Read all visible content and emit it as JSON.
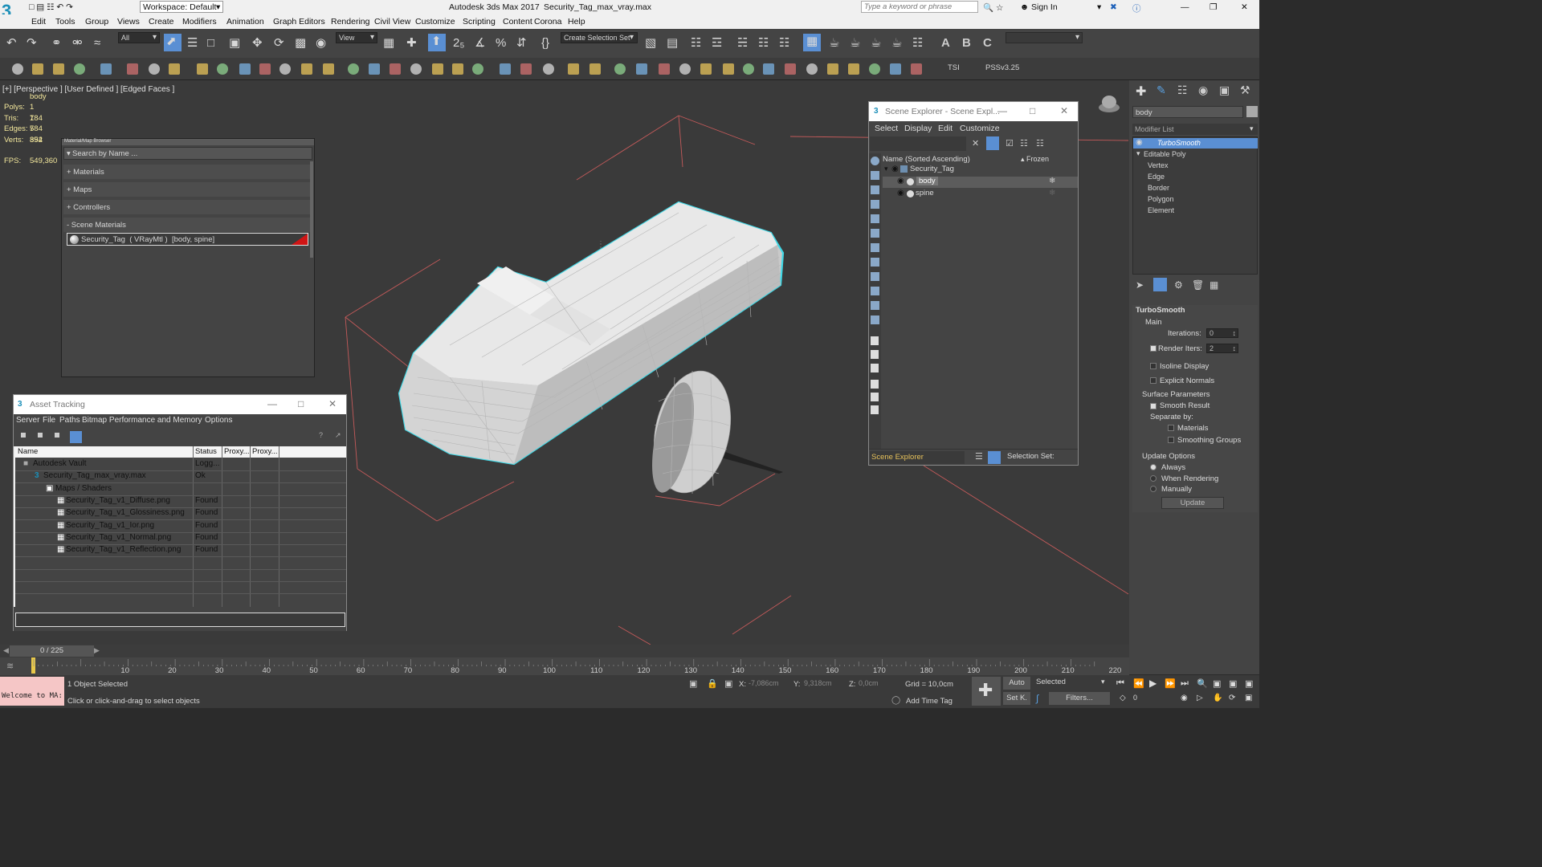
{
  "app": {
    "title": "Autodesk 3ds Max 2017",
    "file": "Security_Tag_max_vray.max",
    "workspace": "Workspace: Default",
    "search_placeholder": "Type a keyword or phrase",
    "sign_in": "Sign In"
  },
  "menu": [
    "Edit",
    "Tools",
    "Group",
    "Views",
    "Create",
    "Modifiers",
    "Animation",
    "Graph Editors",
    "Rendering",
    "Civil View",
    "Customize",
    "Scripting",
    "Content",
    "Corona",
    "Help"
  ],
  "toolbar": {
    "filter": "All",
    "refcoord": "View",
    "selset": "Create Selection Set",
    "tsi": "TSI",
    "pss": "PSSv3.25"
  },
  "viewport": {
    "label": "[+] [Perspective ] [User Defined ] [Edged Faces ]",
    "object": "body",
    "stats": [
      {
        "k": "Polys:",
        "v": "1 784"
      },
      {
        "k": "Tris:",
        "v": "1 784"
      },
      {
        "k": "Edges:",
        "v": "5 352"
      },
      {
        "k": "Verts:",
        "v": "894"
      }
    ],
    "fps_label": "FPS:",
    "fps": "549,360"
  },
  "material_browser": {
    "title": "Material/Map Browser",
    "search": "Search by Name ...",
    "groups": [
      {
        "label": "+ Materials"
      },
      {
        "label": "+ Maps"
      },
      {
        "label": "+ Controllers"
      },
      {
        "label": "- Scene Materials"
      }
    ],
    "scene_material": "Security_Tag  ( VRayMtl )  [body, spine]"
  },
  "asset_tracking": {
    "title": "Asset Tracking",
    "menu": [
      "Server",
      "File",
      "Paths",
      "Bitmap Performance and Memory",
      "Options"
    ],
    "columns": [
      "Name",
      "Status",
      "Proxy...",
      "Proxy..."
    ],
    "rows": [
      {
        "name": "Autodesk Vault",
        "status": "Logg..."
      },
      {
        "name": "Security_Tag_max_vray.max",
        "status": "Ok"
      },
      {
        "name": "Maps / Shaders",
        "status": ""
      },
      {
        "name": "Security_Tag_v1_Diffuse.png",
        "status": "Found"
      },
      {
        "name": "Security_Tag_v1_Glossiness.png",
        "status": "Found"
      },
      {
        "name": "Security_Tag_v1_Ior.png",
        "status": "Found"
      },
      {
        "name": "Security_Tag_v1_Normal.png",
        "status": "Found"
      },
      {
        "name": "Security_Tag_v1_Reflection.png",
        "status": "Found"
      }
    ]
  },
  "scene_explorer": {
    "title": "Scene Explorer - Scene Expl...",
    "menu": [
      "Select",
      "Display",
      "Edit",
      "Customize"
    ],
    "col_name": "Name (Sorted Ascending)",
    "col_frozen": "▴ Frozen",
    "items": [
      {
        "name": "Security_Tag"
      },
      {
        "name": "body"
      },
      {
        "name": "spine"
      }
    ],
    "footer_name": "Scene Explorer",
    "footer_set": "Selection Set:"
  },
  "command_panel": {
    "object_name": "body",
    "modifier_list": "Modifier List",
    "stack": [
      {
        "name": "TurboSmooth"
      },
      {
        "name": "Editable Poly"
      },
      {
        "name": "Vertex"
      },
      {
        "name": "Edge"
      },
      {
        "name": "Border"
      },
      {
        "name": "Polygon"
      },
      {
        "name": "Element"
      }
    ],
    "rollout": "TurboSmooth",
    "main": "Main",
    "iterations_label": "Iterations:",
    "iterations": "0",
    "render_iters_label": "Render Iters:",
    "render_iters": "2",
    "isoline": "Isoline Display",
    "explicit": "Explicit Normals",
    "surface": "Surface Parameters",
    "smooth_result": "Smooth Result",
    "separate": "Separate by:",
    "materials": "Materials",
    "smoothing": "Smoothing Groups",
    "update_options": "Update Options",
    "always": "Always",
    "when_rendering": "When Rendering",
    "manually": "Manually",
    "update": "Update"
  },
  "timeline": {
    "frame": "0 / 225",
    "ticks": [
      "0",
      "10",
      "20",
      "30",
      "40",
      "50",
      "60",
      "70",
      "80",
      "90",
      "100",
      "110",
      "120",
      "130",
      "140",
      "150",
      "160",
      "170",
      "180",
      "190",
      "200",
      "210",
      "220"
    ]
  },
  "status": {
    "maxscript": "Welcome to MA:",
    "selected": "1 Object Selected",
    "prompt": "Click or click-and-drag to select objects",
    "x_label": "X:",
    "x": "-7,086cm",
    "y_label": "Y:",
    "y": "9,318cm",
    "z_label": "Z:",
    "z": "0,0cm",
    "grid": "Grid = 10,0cm",
    "add_time_tag": "Add Time Tag",
    "auto": "Auto",
    "setk": "Set K.",
    "sel_filter": "Selected",
    "filters": "Filters...",
    "frame_field": "0"
  }
}
